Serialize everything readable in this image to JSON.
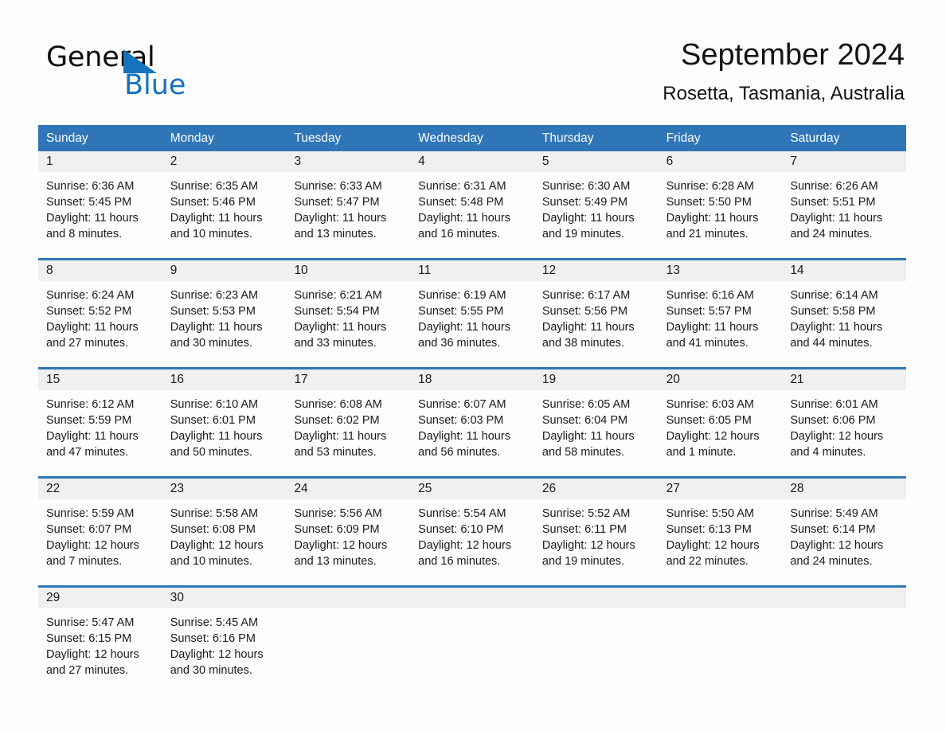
{
  "logo": {
    "word_dark": "General",
    "word_blue": "Blue",
    "triangle_color": "#1572bd"
  },
  "header": {
    "title": "September 2024",
    "subtitle": "Rosetta, Tasmania, Australia"
  },
  "colors": {
    "header_blue": "#2e76b8",
    "daynum_band": "#f0f0f0",
    "page_background": "#fdfdfd",
    "text": "#1a1a1a"
  },
  "weekdays": [
    "Sunday",
    "Monday",
    "Tuesday",
    "Wednesday",
    "Thursday",
    "Friday",
    "Saturday"
  ],
  "weeks": [
    [
      {
        "day": "1",
        "sunrise": "Sunrise: 6:36 AM",
        "sunset": "Sunset: 5:45 PM",
        "daylight1": "Daylight: 11 hours",
        "daylight2": "and 8 minutes."
      },
      {
        "day": "2",
        "sunrise": "Sunrise: 6:35 AM",
        "sunset": "Sunset: 5:46 PM",
        "daylight1": "Daylight: 11 hours",
        "daylight2": "and 10 minutes."
      },
      {
        "day": "3",
        "sunrise": "Sunrise: 6:33 AM",
        "sunset": "Sunset: 5:47 PM",
        "daylight1": "Daylight: 11 hours",
        "daylight2": "and 13 minutes."
      },
      {
        "day": "4",
        "sunrise": "Sunrise: 6:31 AM",
        "sunset": "Sunset: 5:48 PM",
        "daylight1": "Daylight: 11 hours",
        "daylight2": "and 16 minutes."
      },
      {
        "day": "5",
        "sunrise": "Sunrise: 6:30 AM",
        "sunset": "Sunset: 5:49 PM",
        "daylight1": "Daylight: 11 hours",
        "daylight2": "and 19 minutes."
      },
      {
        "day": "6",
        "sunrise": "Sunrise: 6:28 AM",
        "sunset": "Sunset: 5:50 PM",
        "daylight1": "Daylight: 11 hours",
        "daylight2": "and 21 minutes."
      },
      {
        "day": "7",
        "sunrise": "Sunrise: 6:26 AM",
        "sunset": "Sunset: 5:51 PM",
        "daylight1": "Daylight: 11 hours",
        "daylight2": "and 24 minutes."
      }
    ],
    [
      {
        "day": "8",
        "sunrise": "Sunrise: 6:24 AM",
        "sunset": "Sunset: 5:52 PM",
        "daylight1": "Daylight: 11 hours",
        "daylight2": "and 27 minutes."
      },
      {
        "day": "9",
        "sunrise": "Sunrise: 6:23 AM",
        "sunset": "Sunset: 5:53 PM",
        "daylight1": "Daylight: 11 hours",
        "daylight2": "and 30 minutes."
      },
      {
        "day": "10",
        "sunrise": "Sunrise: 6:21 AM",
        "sunset": "Sunset: 5:54 PM",
        "daylight1": "Daylight: 11 hours",
        "daylight2": "and 33 minutes."
      },
      {
        "day": "11",
        "sunrise": "Sunrise: 6:19 AM",
        "sunset": "Sunset: 5:55 PM",
        "daylight1": "Daylight: 11 hours",
        "daylight2": "and 36 minutes."
      },
      {
        "day": "12",
        "sunrise": "Sunrise: 6:17 AM",
        "sunset": "Sunset: 5:56 PM",
        "daylight1": "Daylight: 11 hours",
        "daylight2": "and 38 minutes."
      },
      {
        "day": "13",
        "sunrise": "Sunrise: 6:16 AM",
        "sunset": "Sunset: 5:57 PM",
        "daylight1": "Daylight: 11 hours",
        "daylight2": "and 41 minutes."
      },
      {
        "day": "14",
        "sunrise": "Sunrise: 6:14 AM",
        "sunset": "Sunset: 5:58 PM",
        "daylight1": "Daylight: 11 hours",
        "daylight2": "and 44 minutes."
      }
    ],
    [
      {
        "day": "15",
        "sunrise": "Sunrise: 6:12 AM",
        "sunset": "Sunset: 5:59 PM",
        "daylight1": "Daylight: 11 hours",
        "daylight2": "and 47 minutes."
      },
      {
        "day": "16",
        "sunrise": "Sunrise: 6:10 AM",
        "sunset": "Sunset: 6:01 PM",
        "daylight1": "Daylight: 11 hours",
        "daylight2": "and 50 minutes."
      },
      {
        "day": "17",
        "sunrise": "Sunrise: 6:08 AM",
        "sunset": "Sunset: 6:02 PM",
        "daylight1": "Daylight: 11 hours",
        "daylight2": "and 53 minutes."
      },
      {
        "day": "18",
        "sunrise": "Sunrise: 6:07 AM",
        "sunset": "Sunset: 6:03 PM",
        "daylight1": "Daylight: 11 hours",
        "daylight2": "and 56 minutes."
      },
      {
        "day": "19",
        "sunrise": "Sunrise: 6:05 AM",
        "sunset": "Sunset: 6:04 PM",
        "daylight1": "Daylight: 11 hours",
        "daylight2": "and 58 minutes."
      },
      {
        "day": "20",
        "sunrise": "Sunrise: 6:03 AM",
        "sunset": "Sunset: 6:05 PM",
        "daylight1": "Daylight: 12 hours",
        "daylight2": "and 1 minute."
      },
      {
        "day": "21",
        "sunrise": "Sunrise: 6:01 AM",
        "sunset": "Sunset: 6:06 PM",
        "daylight1": "Daylight: 12 hours",
        "daylight2": "and 4 minutes."
      }
    ],
    [
      {
        "day": "22",
        "sunrise": "Sunrise: 5:59 AM",
        "sunset": "Sunset: 6:07 PM",
        "daylight1": "Daylight: 12 hours",
        "daylight2": "and 7 minutes."
      },
      {
        "day": "23",
        "sunrise": "Sunrise: 5:58 AM",
        "sunset": "Sunset: 6:08 PM",
        "daylight1": "Daylight: 12 hours",
        "daylight2": "and 10 minutes."
      },
      {
        "day": "24",
        "sunrise": "Sunrise: 5:56 AM",
        "sunset": "Sunset: 6:09 PM",
        "daylight1": "Daylight: 12 hours",
        "daylight2": "and 13 minutes."
      },
      {
        "day": "25",
        "sunrise": "Sunrise: 5:54 AM",
        "sunset": "Sunset: 6:10 PM",
        "daylight1": "Daylight: 12 hours",
        "daylight2": "and 16 minutes."
      },
      {
        "day": "26",
        "sunrise": "Sunrise: 5:52 AM",
        "sunset": "Sunset: 6:11 PM",
        "daylight1": "Daylight: 12 hours",
        "daylight2": "and 19 minutes."
      },
      {
        "day": "27",
        "sunrise": "Sunrise: 5:50 AM",
        "sunset": "Sunset: 6:13 PM",
        "daylight1": "Daylight: 12 hours",
        "daylight2": "and 22 minutes."
      },
      {
        "day": "28",
        "sunrise": "Sunrise: 5:49 AM",
        "sunset": "Sunset: 6:14 PM",
        "daylight1": "Daylight: 12 hours",
        "daylight2": "and 24 minutes."
      }
    ],
    [
      {
        "day": "29",
        "sunrise": "Sunrise: 5:47 AM",
        "sunset": "Sunset: 6:15 PM",
        "daylight1": "Daylight: 12 hours",
        "daylight2": "and 27 minutes."
      },
      {
        "day": "30",
        "sunrise": "Sunrise: 5:45 AM",
        "sunset": "Sunset: 6:16 PM",
        "daylight1": "Daylight: 12 hours",
        "daylight2": "and 30 minutes."
      },
      {
        "day": "",
        "sunrise": "",
        "sunset": "",
        "daylight1": "",
        "daylight2": ""
      },
      {
        "day": "",
        "sunrise": "",
        "sunset": "",
        "daylight1": "",
        "daylight2": ""
      },
      {
        "day": "",
        "sunrise": "",
        "sunset": "",
        "daylight1": "",
        "daylight2": ""
      },
      {
        "day": "",
        "sunrise": "",
        "sunset": "",
        "daylight1": "",
        "daylight2": ""
      },
      {
        "day": "",
        "sunrise": "",
        "sunset": "",
        "daylight1": "",
        "daylight2": ""
      }
    ]
  ]
}
